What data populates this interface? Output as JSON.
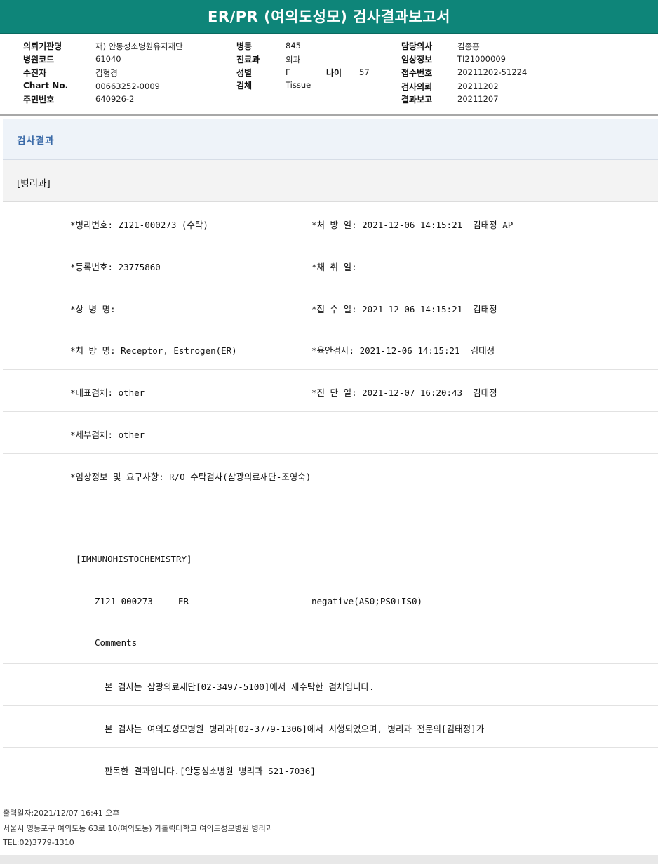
{
  "title": "ER/PR (여의도성모) 검사결과보고서",
  "header": {
    "hospital_label": "의뢰기관명",
    "hospital_value": "재) 안동성소병원유지재단",
    "code_label": "병원코드",
    "code_value": "61040",
    "patient_label": "수진자",
    "patient_value": "김형경",
    "chart_label": "Chart No.",
    "chart_value": "00663252-0009",
    "id_label": "주민번호",
    "id_value": "640926-2",
    "ward_label": "병동",
    "ward_value": "845",
    "dept_label": "진료과",
    "dept_value": "외과",
    "sex_label": "성별",
    "sex_value": "F",
    "age_label": "나이",
    "age_value": "57",
    "specimen_label": "검체",
    "specimen_value": "Tissue",
    "doctor_label": "담당의사",
    "doctor_value": "김종홍",
    "clinical_label": "임상정보",
    "clinical_value": "TI21000009",
    "receipt_label": "접수번호",
    "receipt_value": "20211202-51224",
    "request_label": "검사의뢰",
    "request_value": "20211202",
    "report_label": "결과보고",
    "report_value": "20211207"
  },
  "section_title": "검사결과",
  "department": "[병리과]",
  "rows": [
    {
      "left": "*병리번호: Z121-000273 (수탁)",
      "right": "*처 방 일: 2021-12-06 14:15:21  김태정 AP"
    },
    {
      "left": "*등록번호: 23775860",
      "right": "*채 취 일:"
    },
    {
      "left": "*상 병 명: -",
      "right": "*접 수 일: 2021-12-06 14:15:21  김태정"
    },
    {
      "left": "*처 방 명: Receptor, Estrogen(ER)",
      "right": "*육안검사: 2021-12-06 14:15:21  김태정"
    },
    {
      "left": "*대표검체: other",
      "right": "*진 단 일: 2021-12-07 16:20:43  김태정"
    },
    {
      "left": "*세부검체: other",
      "right": ""
    },
    {
      "left": "*임상정보 및 요구사항: R/O 수탁검사(삼광의료재단-조영숙)",
      "right": ""
    }
  ],
  "ihc_title": "[IMMUNOHISTOCHEMISTRY]",
  "ihc_result": {
    "id": "Z121-000273",
    "marker": "ER",
    "result": "negative(AS0;PS0+IS0)"
  },
  "comments_label": "Comments",
  "comment_lines": [
    "본 검사는 삼광의료재단[02-3497-5100]에서 재수탁한 검체입니다.",
    "본 검사는 여의도성모병원 병리과[02-3779-1306]에서 시행되었으며, 병리과 전문의[김태정]가",
    "판독한 결과입니다.[안동성소병원 병리과 S21-7036]"
  ],
  "footer": {
    "print_date": "출력일자:2021/12/07 16:41 오후",
    "address": "서울시 영등포구 여의도동 63로 10(여의도동) 가톨릭대학교 여의도성모병원 병리과",
    "tel": "TEL:02)3779-1310"
  }
}
